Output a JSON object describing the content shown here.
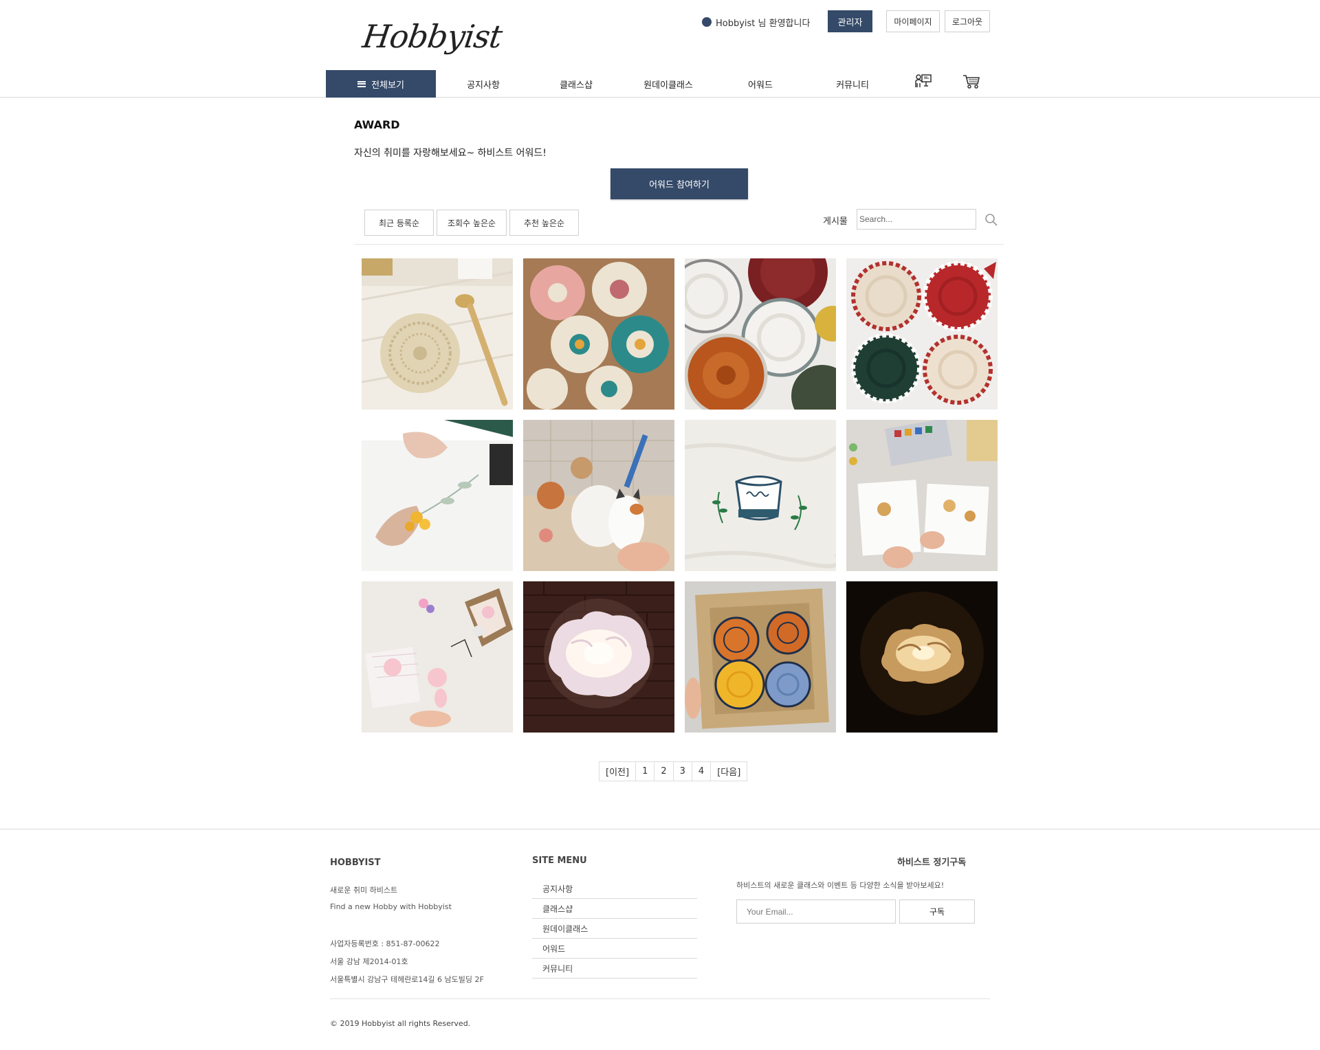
{
  "header": {
    "logo_text": "Hobbyist",
    "welcome_text": "Hobbyist 님 환영합니다",
    "admin_label": "관리자",
    "mypage_label": "마이페이지",
    "logout_label": "로그아웃"
  },
  "nav": {
    "all_label": "전체보기",
    "items": [
      "공지사항",
      "클래스샵",
      "원데이클래스",
      "어워드",
      "커뮤니티"
    ],
    "icons": [
      "class-board-icon",
      "cart-icon"
    ]
  },
  "main": {
    "title": "AWARD",
    "description": "자신의 취미를 자랑해보세요~ 하비스트 어워드!",
    "join_label": "어워드 참여하기",
    "sort": [
      "최근 등록순",
      "조회수 높은순",
      "추천 높은순"
    ],
    "search_label": "게시물",
    "search_placeholder": "Search..."
  },
  "gallery": {
    "images": [
      "crochet-doily-with-spoon",
      "colorful-flower-crochet-mat",
      "knitted-coasters-orange-red",
      "knitted-coasters-christmas",
      "watercolor-leaf-painting",
      "clay-cat-figurine-painting",
      "stay-embroidery",
      "watercolor-dog-painting",
      "felt-pig-dolls",
      "flower-lamp-lit",
      "punch-needle-flower-rug",
      "flower-lamp-dark"
    ]
  },
  "pagination": [
    "[이전]",
    "1",
    "2",
    "3",
    "4",
    "[다음]"
  ],
  "footer": {
    "brand": "HOBBYIST",
    "lines": [
      "새로운 취미 하비스트",
      "Find a new Hobby with Hobbyist",
      "사업자등록번호 : 851-87-00622",
      "서울 강남 제2014-01호",
      "서울특별시 강남구 테헤란로14길 6 남도빌딩 2F"
    ],
    "menu_title": "SITE MENU",
    "menu_items": [
      "공지사항",
      "클래스샵",
      "원데이클래스",
      "어워드",
      "커뮤니티"
    ],
    "subscribe_title": "하비스트 정기구독",
    "subscribe_desc": "하비스트의 새로운 클래스와 이벤트 등 다양한 소식을 받아보세요!",
    "email_placeholder": "Your Email...",
    "subscribe_label": "구독",
    "copyright": "© 2019 Hobbyist all rights Reserved."
  },
  "colors": {
    "primary": "#354a69",
    "border": "#d0d0d0"
  }
}
